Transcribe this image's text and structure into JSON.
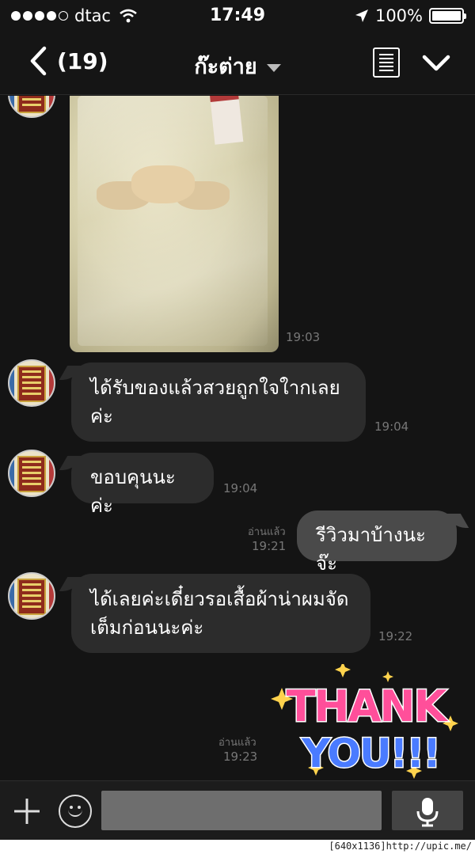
{
  "status_bar": {
    "carrier": "dtac",
    "time": "17:49",
    "battery": "100%",
    "signal_bars": 4
  },
  "nav": {
    "back_count": "(19)",
    "title": "ก๊ะต่าย"
  },
  "messages": [
    {
      "from": "them",
      "kind": "image",
      "time": "19:03"
    },
    {
      "from": "them",
      "kind": "text",
      "lines": [
        "ได้รับของแล้วสวยถูกใจใากเลย",
        "ค่ะ"
      ],
      "time": "19:04"
    },
    {
      "from": "them",
      "kind": "text",
      "lines": [
        "ขอบคุนนะค่ะ"
      ],
      "time": "19:04"
    },
    {
      "from": "me",
      "kind": "text",
      "lines": [
        "รีวิวมาบ้างนะจ๊ะ"
      ],
      "read": "อ่านแล้ว",
      "time": "19:21"
    },
    {
      "from": "them",
      "kind": "text",
      "lines": [
        "ได้เลยค่ะเดี๋ยวรอเสื้อผ้าน่าผมจัด",
        "เต็มก่อนนะค่ะ"
      ],
      "time": "19:22"
    },
    {
      "from": "me",
      "kind": "sticker",
      "sticker_text": [
        "THANK",
        "YOU!!!"
      ],
      "read": "อ่านแล้ว",
      "time": "19:23"
    }
  ],
  "input": {
    "value": "",
    "placeholder": ""
  },
  "watermark": "[640x1136]http://upic.me/",
  "colors": {
    "background": "#141414",
    "bubble_in": "#2c2c2c",
    "bubble_out": "#4a4a4a",
    "sticker_pink": "#ff4f9a",
    "sticker_blue": "#4a7bff"
  }
}
